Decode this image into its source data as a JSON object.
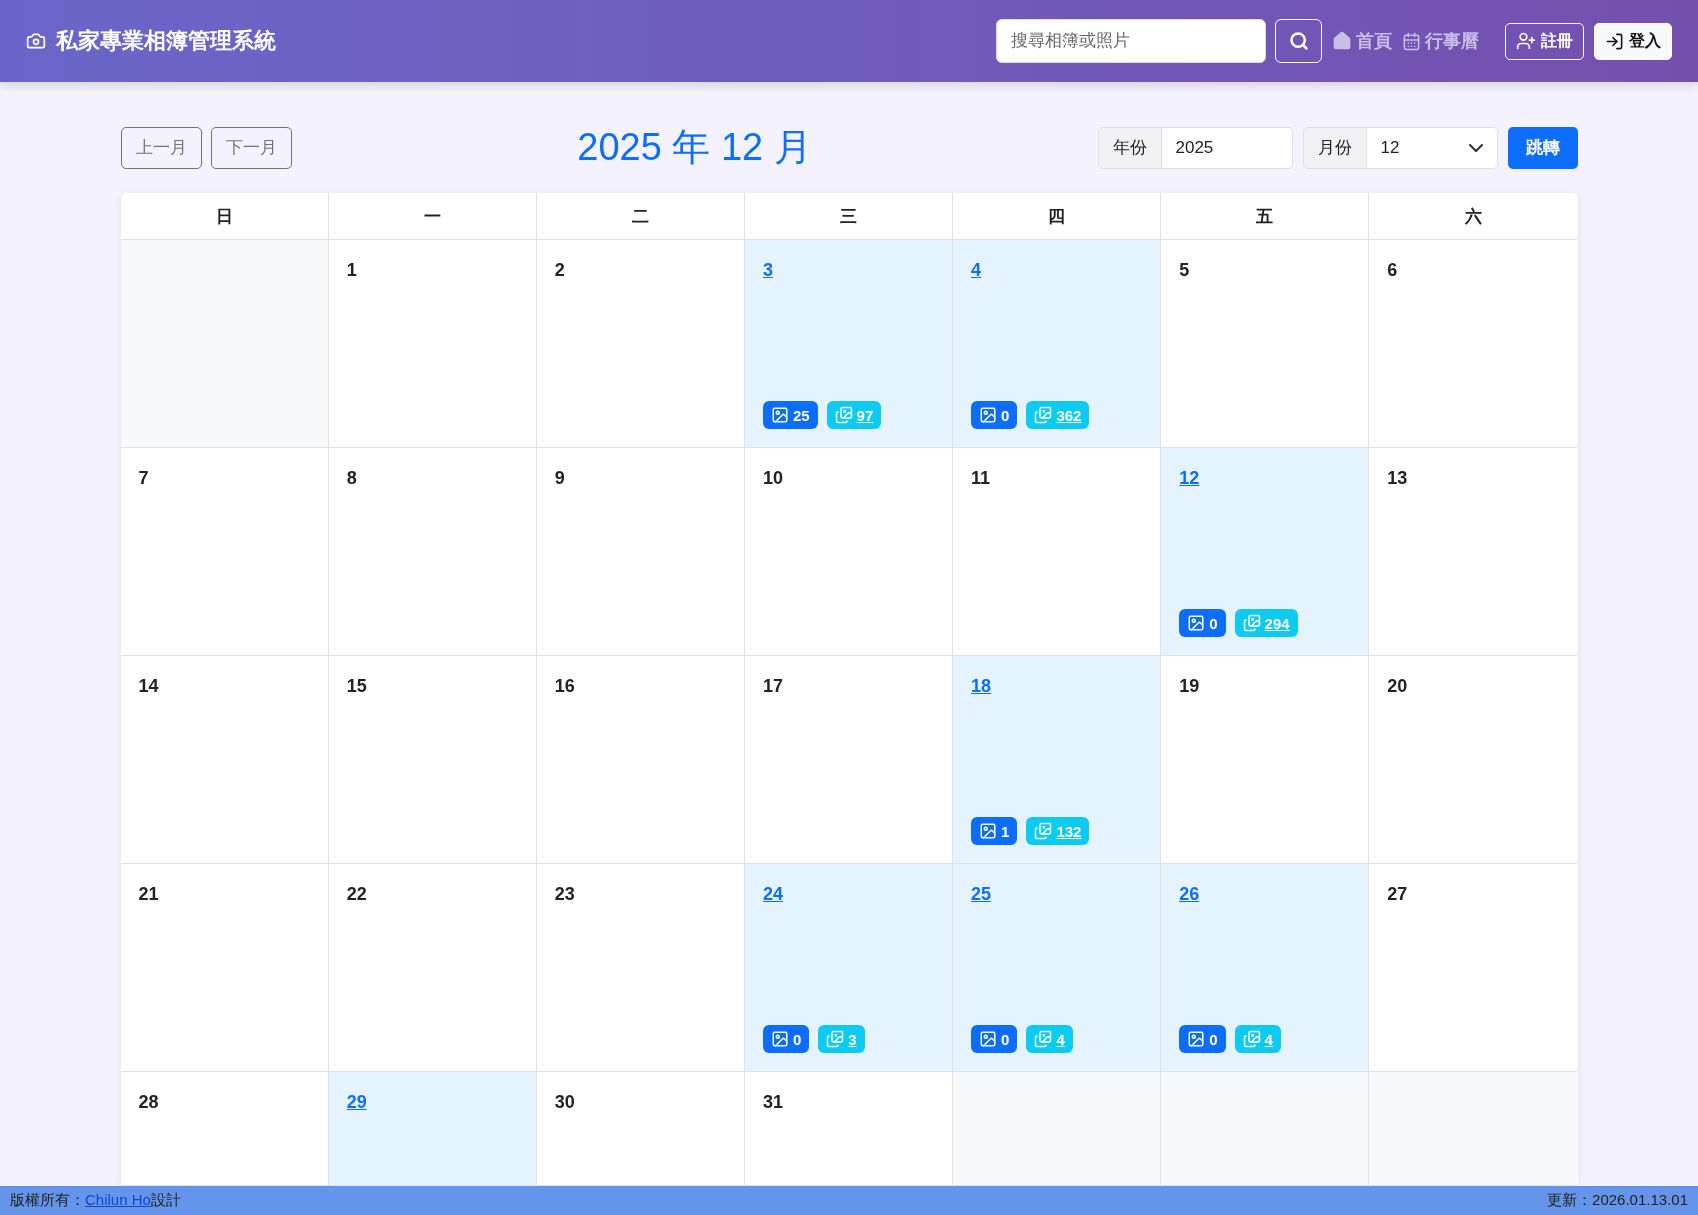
{
  "brand": "私家專業相簿管理系統",
  "search": {
    "placeholder": "搜尋相簿或照片"
  },
  "nav": [
    {
      "label": "首頁",
      "kind": "home"
    },
    {
      "label": "行事曆",
      "kind": "calendar"
    }
  ],
  "auth": [
    {
      "label": "註冊",
      "kind": "register"
    },
    {
      "label": "登入",
      "kind": "login"
    }
  ],
  "toolbar": {
    "prev": "上一月",
    "next": "下一月",
    "title": "2025 年 12 月",
    "year_label": "年份",
    "year": "2025",
    "month_label": "月份",
    "month": "12",
    "go": "跳轉"
  },
  "weekdays": [
    "日",
    "一",
    "二",
    "三",
    "四",
    "五",
    "六"
  ],
  "weeks": [
    [
      {
        "kind": "blank"
      },
      {
        "day": "1",
        "linked": false
      },
      {
        "day": "2",
        "linked": false
      },
      {
        "day": "3",
        "linked": true,
        "albums": "25",
        "photos": "97"
      },
      {
        "day": "4",
        "linked": true,
        "albums": "0",
        "photos": "362"
      },
      {
        "day": "5",
        "linked": false
      },
      {
        "day": "6",
        "linked": false
      }
    ],
    [
      {
        "day": "7",
        "linked": false
      },
      {
        "day": "8",
        "linked": false
      },
      {
        "day": "9",
        "linked": false
      },
      {
        "day": "10",
        "linked": false
      },
      {
        "day": "11",
        "linked": false
      },
      {
        "day": "12",
        "linked": true,
        "albums": "0",
        "photos": "294"
      },
      {
        "day": "13",
        "linked": false
      }
    ],
    [
      {
        "day": "14",
        "linked": false
      },
      {
        "day": "15",
        "linked": false
      },
      {
        "day": "16",
        "linked": false
      },
      {
        "day": "17",
        "linked": false
      },
      {
        "day": "18",
        "linked": true,
        "albums": "1",
        "photos": "132"
      },
      {
        "day": "19",
        "linked": false
      },
      {
        "day": "20",
        "linked": false
      }
    ],
    [
      {
        "day": "21",
        "linked": false
      },
      {
        "day": "22",
        "linked": false
      },
      {
        "day": "23",
        "linked": false
      },
      {
        "day": "24",
        "linked": true,
        "albums": "0",
        "photos": "3"
      },
      {
        "day": "25",
        "linked": true,
        "albums": "0",
        "photos": "4"
      },
      {
        "day": "26",
        "linked": true,
        "albums": "0",
        "photos": "4"
      },
      {
        "day": "27",
        "linked": false
      }
    ],
    [
      {
        "day": "28",
        "linked": false
      },
      {
        "day": "29",
        "linked": true
      },
      {
        "day": "30",
        "linked": false
      },
      {
        "day": "31",
        "linked": false
      },
      {
        "kind": "blank"
      },
      {
        "kind": "blank"
      },
      {
        "kind": "blank"
      }
    ]
  ],
  "footer": {
    "copyright": "版權所有：",
    "author": "Chilun Ho",
    "suffix": "設計",
    "updated": "更新：2026.01.13.01"
  }
}
